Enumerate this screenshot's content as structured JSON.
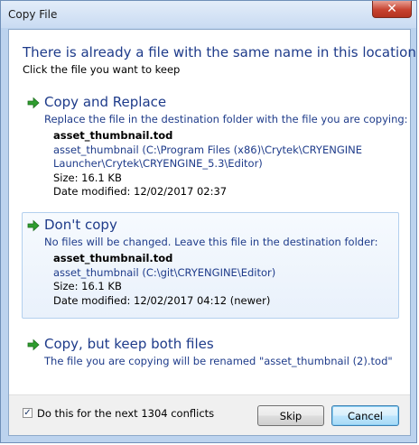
{
  "window": {
    "title": "Copy File",
    "close_glyph": "✕"
  },
  "dialog": {
    "main_instruction": "There is already a file with the same name in this location.",
    "sub_instruction": "Click the file you want to keep"
  },
  "options": {
    "replace": {
      "title": "Copy and Replace",
      "description": "Replace the file in the destination folder with the file you are copying:",
      "file": {
        "name": "asset_thumbnail.tod",
        "path_line1": "asset_thumbnail (C:\\Program Files (x86)\\Crytek\\CRYENGINE",
        "path_line2": "Launcher\\Crytek\\CRYENGINE_5.3\\Editor)",
        "size": "Size: 16.1 KB",
        "date": "Date modified: 12/02/2017 02:37"
      }
    },
    "dont_copy": {
      "title": "Don't copy",
      "description": "No files will be changed. Leave this file in the destination folder:",
      "file": {
        "name": "asset_thumbnail.tod",
        "path_line1": "asset_thumbnail (C:\\git\\CRYENGINE\\Editor)",
        "size": "Size: 16.1 KB",
        "date": "Date modified: 12/02/2017 04:12 (newer)"
      }
    },
    "keep_both": {
      "title": "Copy, but keep both files",
      "description": "The file you are copying will be renamed \"asset_thumbnail (2).tod\""
    }
  },
  "footer": {
    "checkbox_checked": true,
    "checkbox_glyph": "✓",
    "checkbox_label": "Do this for the next 1304 conflicts",
    "skip_label": "Skip",
    "cancel_label": "Cancel"
  },
  "icons": {
    "option_arrow": "green-arrow-icon"
  },
  "colors": {
    "instruction_blue": "#1e3b8a",
    "arrow_green": "#2e9d2e",
    "hover_border": "#b3d0ee"
  }
}
